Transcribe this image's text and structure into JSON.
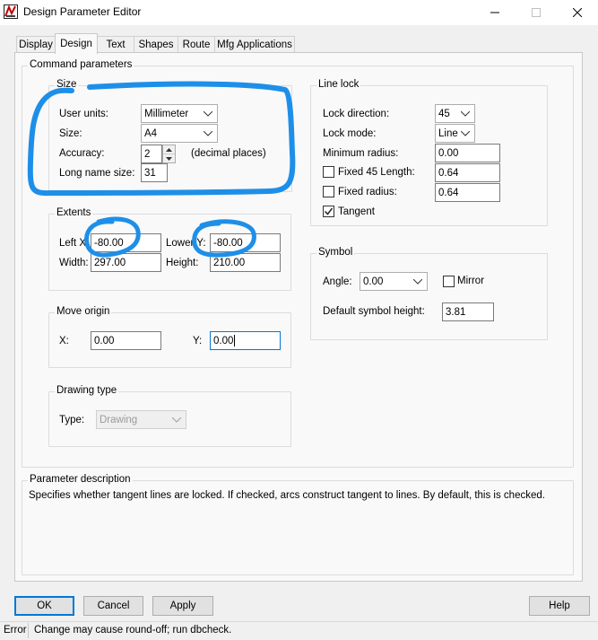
{
  "window": {
    "title": "Design Parameter Editor",
    "minimize_icon": "minimize-icon",
    "maximize_icon": "maximize-icon",
    "close_icon": "close-icon"
  },
  "tabs": [
    {
      "label": "Display"
    },
    {
      "label": "Design",
      "active": true
    },
    {
      "label": "Text"
    },
    {
      "label": "Shapes"
    },
    {
      "label": "Route"
    },
    {
      "label": "Mfg Applications"
    }
  ],
  "command_parameters": {
    "title": "Command parameters",
    "size": {
      "title": "Size",
      "user_units_label": "User units:",
      "user_units_value": "Millimeter",
      "size_label": "Size:",
      "size_value": "A4",
      "accuracy_label": "Accuracy:",
      "accuracy_value": "2",
      "accuracy_suffix": "(decimal places)",
      "long_name_label": "Long name size:",
      "long_name_value": "31"
    },
    "extents": {
      "title": "Extents",
      "left_x_label": "Left X:",
      "left_x_value": "-80.00",
      "lower_y_label": "Lower Y:",
      "lower_y_value": "-80.00",
      "width_label": "Width:",
      "width_value": "297.00",
      "height_label": "Height:",
      "height_value": "210.00"
    },
    "move_origin": {
      "title": "Move origin",
      "x_label": "X:",
      "x_value": "0.00",
      "y_label": "Y:",
      "y_value": "0.00"
    },
    "drawing_type": {
      "title": "Drawing type",
      "type_label": "Type:",
      "type_value": "Drawing"
    },
    "line_lock": {
      "title": "Line lock",
      "lock_direction_label": "Lock direction:",
      "lock_direction_value": "45",
      "lock_mode_label": "Lock mode:",
      "lock_mode_value": "Line",
      "min_radius_label": "Minimum radius:",
      "min_radius_value": "0.00",
      "fixed45_label": "Fixed 45 Length:",
      "fixed45_checked": false,
      "fixed45_value": "0.64",
      "fixed_radius_label": "Fixed radius:",
      "fixed_radius_checked": false,
      "fixed_radius_value": "0.64",
      "tangent_label": "Tangent",
      "tangent_checked": true
    },
    "symbol": {
      "title": "Symbol",
      "angle_label": "Angle:",
      "angle_value": "0.00",
      "mirror_label": "Mirror",
      "mirror_checked": false,
      "default_height_label": "Default symbol height:",
      "default_height_value": "3.81"
    }
  },
  "parameter_description": {
    "title": "Parameter description",
    "text": "Specifies whether tangent lines are locked. If checked, arcs construct tangent to lines. By default, this is checked."
  },
  "buttons": {
    "ok": "OK",
    "cancel": "Cancel",
    "apply": "Apply",
    "help": "Help"
  },
  "status": {
    "type": "Error",
    "message": "Change may cause round-off; run dbcheck."
  },
  "annotation_color": "#1e8fe8"
}
